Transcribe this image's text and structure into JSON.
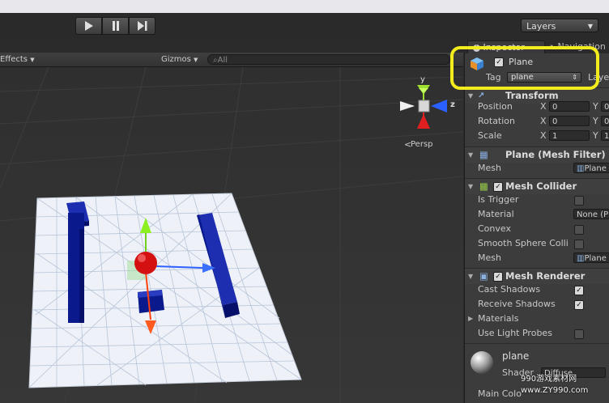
{
  "toolbar": {
    "play_icon": "play-icon",
    "pause_icon": "pause-icon",
    "step_icon": "step-icon",
    "layers_label": "Layers"
  },
  "scene_bar": {
    "effects_label": "Effects",
    "gizmos_label": "Gizmos",
    "search_value": "All"
  },
  "gizmo": {
    "y_label": "y",
    "z_label": "z",
    "persp_label": "Persp"
  },
  "inspector": {
    "tab_label": "Inspector",
    "nav_tab_label": "Navigation",
    "object_name": "Plane",
    "tag_label": "Tag",
    "tag_value": "plane",
    "layer_label": "Layer",
    "transform": {
      "title": "Transform",
      "position_label": "Position",
      "rotation_label": "Rotation",
      "scale_label": "Scale",
      "x": "X",
      "y": "Y",
      "position_x": "0",
      "rotation_x": "0",
      "scale_x": "1",
      "position_y": "0",
      "rotation_y": "0",
      "scale_y": "1"
    },
    "mesh_filter": {
      "title": "Plane (Mesh Filter)",
      "mesh_label": "Mesh",
      "mesh_value": "Plane"
    },
    "mesh_collider": {
      "title": "Mesh Collider",
      "is_trigger_label": "Is Trigger",
      "material_label": "Material",
      "material_value": "None (P",
      "convex_label": "Convex",
      "smooth_label": "Smooth Sphere Colli",
      "mesh_label": "Mesh",
      "mesh_value": "Plane"
    },
    "mesh_renderer": {
      "title": "Mesh Renderer",
      "cast_label": "Cast Shadows",
      "receive_label": "Receive Shadows",
      "materials_label": "Materials",
      "light_probes_label": "Use Light Probes"
    },
    "material": {
      "name": "plane",
      "shader_label": "Shader",
      "shader_value": "Diffuse",
      "main_color_label": "Main Colo"
    }
  },
  "watermark": {
    "line1": "990游戏素材网",
    "line2": "www.ZY990.com"
  },
  "colors": {
    "highlight": "#f2ec1f",
    "plane": "#eef2f8",
    "blocks": "#0a1a8c",
    "sphere": "#d41010"
  }
}
